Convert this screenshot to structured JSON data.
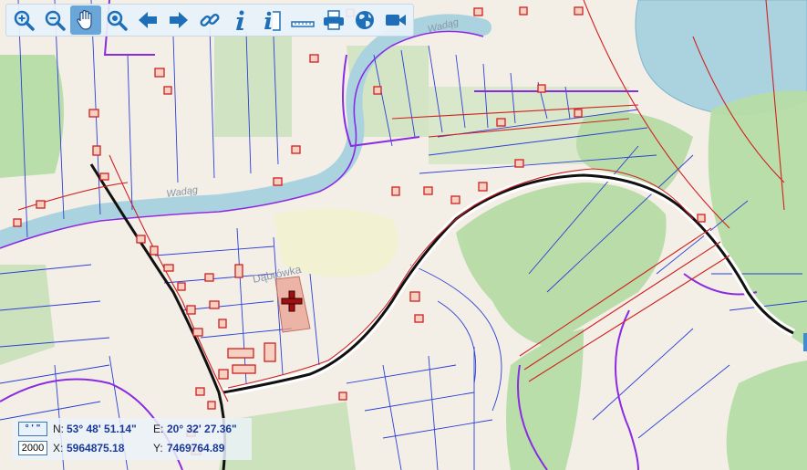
{
  "toolbar": {
    "buttons": [
      {
        "icon": "zoom-in-icon"
      },
      {
        "icon": "zoom-out-icon"
      },
      {
        "icon": "pan-hand-icon",
        "active": true
      },
      {
        "icon": "zoom-extent-icon"
      },
      {
        "icon": "arrow-left-icon"
      },
      {
        "icon": "arrow-right-icon"
      },
      {
        "icon": "link-icon"
      },
      {
        "icon": "info-icon"
      },
      {
        "icon": "info-document-icon"
      },
      {
        "icon": "ruler-icon"
      },
      {
        "icon": "printer-icon"
      },
      {
        "icon": "globe-icon"
      },
      {
        "icon": "video-camera-icon"
      }
    ],
    "active_color": "#6aa6d8"
  },
  "map": {
    "labels": {
      "river_left": "Wadąg",
      "river_top": "Wadąg",
      "place": "Dąbrówka"
    }
  },
  "coordinates": {
    "format_button": "° ' \"",
    "scale": "2000",
    "n_label": "N:",
    "n_value": "53° 48' 51.14\"",
    "e_label": "E:",
    "e_value": "20° 32' 27.36\"",
    "x_label": "X:",
    "x_value": "5964875.18",
    "y_label": "Y:",
    "y_value": "7469764.89"
  },
  "colors": {
    "parcel_lines": "#2b3fd6",
    "utility_lines": "#d02020",
    "boundary": "#8a2be2",
    "forest": "#a8d89a",
    "water": "#aad3df",
    "marker": "#b01818"
  }
}
